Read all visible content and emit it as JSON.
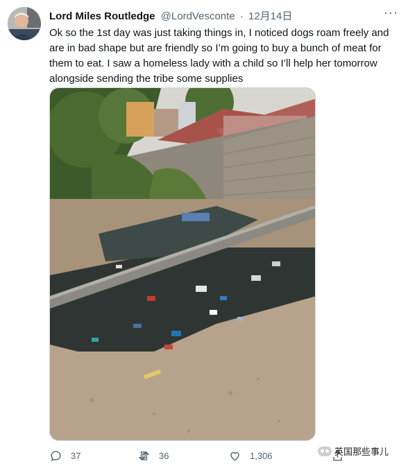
{
  "tweet": {
    "author_name": "Lord Miles Routledge",
    "author_handle": "@LordVesconte",
    "separator": "·",
    "date": "12月14日",
    "more_label": "···",
    "text": "Ok so the 1st day was just taking things in, I noticed dogs roam freely and are in bad shape but are friendly so I’m going to buy a bunch of meat for them to eat. I saw a homeless lady with a child so I’ll help her tomorrow alongside sending the tribe some supplies"
  },
  "actions": {
    "reply_count": "37",
    "retweet_count": "36",
    "like_count": "1,306",
    "reply_icon": "reply-icon",
    "retweet_icon": "retweet-icon",
    "like_icon": "heart-icon",
    "share_icon": "share-icon"
  },
  "watermark": {
    "text": "英国那些事儿"
  },
  "colors": {
    "text_primary": "#0f1419",
    "text_secondary": "#536471",
    "border": "#cfd9de"
  }
}
